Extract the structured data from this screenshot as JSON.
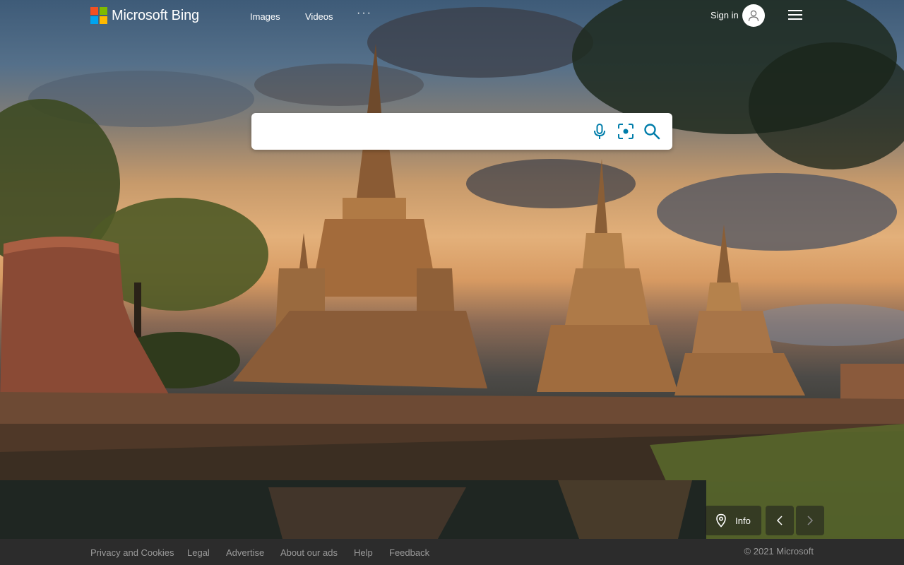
{
  "brand": {
    "name": "Microsoft Bing"
  },
  "nav": {
    "images_label": "Images",
    "videos_label": "Videos",
    "more_label": "···"
  },
  "account": {
    "signin_label": "Sign in"
  },
  "search": {
    "value": "",
    "placeholder": "",
    "icons": [
      "microphone-icon",
      "visual-search-icon",
      "search-icon"
    ]
  },
  "image_controls": {
    "info_label": "Info",
    "icons": [
      "location-pin-icon",
      "chevron-left-icon",
      "chevron-right-icon"
    ]
  },
  "footer": {
    "links": [
      "Privacy and Cookies",
      "Legal",
      "Advertise",
      "About our ads",
      "Help",
      "Feedback"
    ],
    "copyright": "© 2021 Microsoft"
  },
  "colors": {
    "ms_red": "#f25022",
    "ms_green": "#7fba00",
    "ms_blue": "#00a4ef",
    "ms_yellow": "#ffb900",
    "search_icon_blue": "#007daa",
    "footer_bg": "#2c2c2c",
    "footer_text": "#9a9a9a"
  }
}
